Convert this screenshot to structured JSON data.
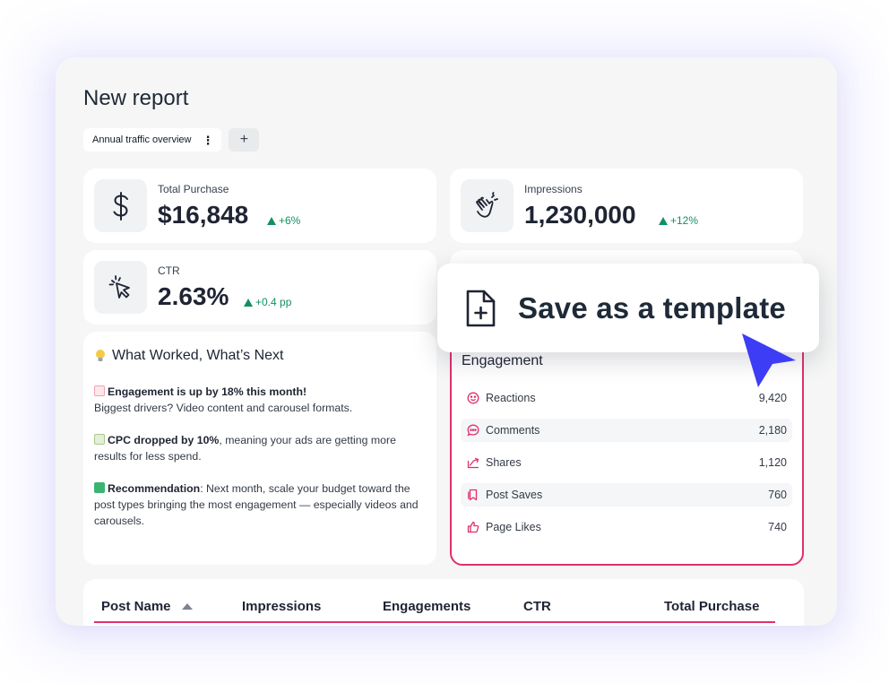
{
  "page": {
    "title": "New report"
  },
  "tabs": {
    "active_label": "Annual traffic overview",
    "kebab": "⋮",
    "add": "+"
  },
  "kpis": [
    {
      "label": "Total Purchase",
      "value": "$16,848",
      "delta": "+6%",
      "icon": "dollar-icon"
    },
    {
      "label": "Impressions",
      "value": "1,230,000",
      "delta": "+12%",
      "icon": "clapping-hands-icon"
    },
    {
      "label": "CTR",
      "value": "2.63%",
      "delta": "+0.4 pp",
      "icon": "click-cursor-icon"
    }
  ],
  "insights": {
    "title": "What Worked, What’s Next",
    "p1_bold": "Engagement is up by 18% this month!",
    "p1_text": "Biggest drivers? Video content and carousel formats.",
    "p2_bold": "CPC dropped by 10%",
    "p2_text": ", meaning your ads are getting more results for less spend.",
    "p3_bold": "Recommendation",
    "p3_text": ": Next month, scale your budget toward the post types bringing the most engagement — especially videos and carousels."
  },
  "engagement": {
    "title": "Engagement",
    "rows": [
      {
        "label": "Reactions",
        "value": "9,420",
        "icon": "smiley-icon"
      },
      {
        "label": "Comments",
        "value": "2,180",
        "icon": "comment-icon"
      },
      {
        "label": "Shares",
        "value": "1,120",
        "icon": "share-arrow-icon"
      },
      {
        "label": "Post Saves",
        "value": "760",
        "icon": "bookmark-icon"
      },
      {
        "label": "Page Likes",
        "value": "740",
        "icon": "thumbs-up-icon"
      }
    ]
  },
  "table": {
    "headers": [
      "Post Name",
      "Impressions",
      "Engagements",
      "CTR",
      "Total Purchase"
    ]
  },
  "popup": {
    "label": "Save as a template"
  },
  "colors": {
    "accent_pink": "#e0306b",
    "positive": "#12915f",
    "cursor": "#3d3df5"
  }
}
